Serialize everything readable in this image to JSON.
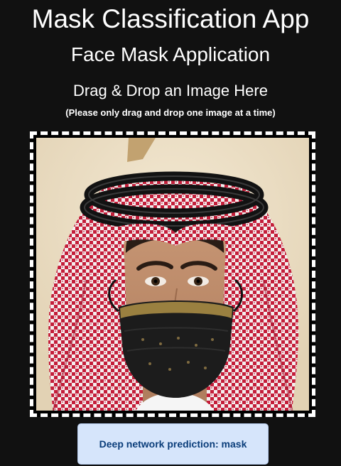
{
  "header": {
    "title": "Mask Classification App",
    "subtitle": "Face Mask Application"
  },
  "dropzone": {
    "heading": "Drag & Drop an Image Here",
    "note": "(Please only drag and drop one image at a time)",
    "image_icon": "uploaded-face-photo"
  },
  "result": {
    "prediction_text": "Deep network prediction: mask"
  },
  "colors": {
    "background": "#111111",
    "text": "#ffffff",
    "prediction_bg": "#d6e5fb",
    "prediction_text": "#0a3d7a",
    "headdress_red": "#c41e3a",
    "mask_black": "#1c1c1c",
    "mask_gold_band": "#9a8040"
  }
}
